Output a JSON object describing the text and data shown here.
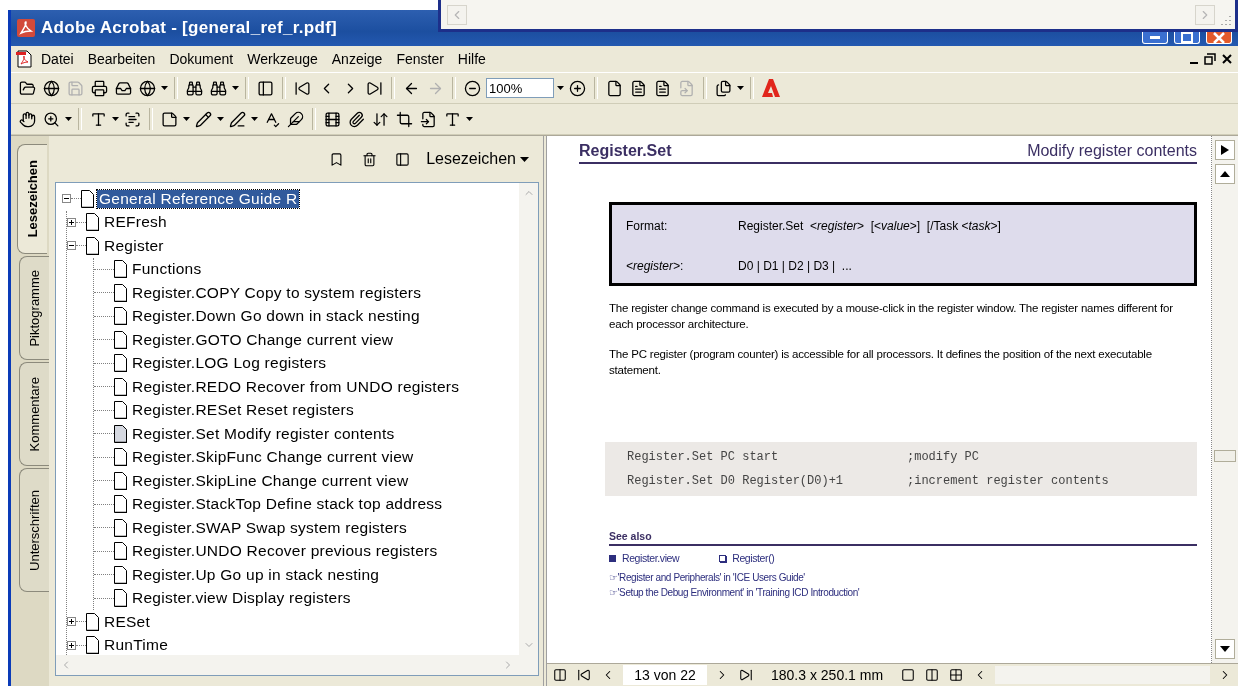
{
  "window": {
    "title": "Adobe Acrobat - [general_ref_r.pdf]"
  },
  "menu": [
    "Datei",
    "Bearbeiten",
    "Dokument",
    "Werkzeuge",
    "Anzeige",
    "Fenster",
    "Hilfe"
  ],
  "toolbar": {
    "zoom": "100%"
  },
  "side_tabs": [
    {
      "label": "Lesezeichen",
      "selected": true
    },
    {
      "label": "Piktogramme",
      "selected": false
    },
    {
      "label": "Kommentare",
      "selected": false
    },
    {
      "label": "Unterschriften",
      "selected": false
    }
  ],
  "bookmarks": {
    "menu": "Lesezeichen",
    "tree": [
      {
        "label": "General Reference Guide R",
        "expanded": true,
        "selected": true,
        "children": [
          {
            "label": "REFresh",
            "expanded": false,
            "selected": false
          },
          {
            "label": "Register",
            "expanded": true,
            "selected": false,
            "children": [
              {
                "label": "Functions",
                "current": false
              },
              {
                "label": "Register.COPY Copy to system registers",
                "current": false
              },
              {
                "label": "Register.Down Go down in stack nesting",
                "current": false
              },
              {
                "label": "Register.GOTO Change current view",
                "current": false
              },
              {
                "label": "Register.LOG Log registers",
                "current": false
              },
              {
                "label": "Register.REDO Recover from UNDO registers",
                "current": false
              },
              {
                "label": "Register.RESet Reset registers",
                "current": false
              },
              {
                "label": "Register.Set Modify register contents",
                "current": true
              },
              {
                "label": "Register.SkipFunc Change current view",
                "current": false
              },
              {
                "label": "Register.SkipLine Change current view",
                "current": false
              },
              {
                "label": "Register.StackTop Define stack top address",
                "current": false
              },
              {
                "label": "Register.SWAP Swap system registers",
                "current": false
              },
              {
                "label": "Register.UNDO Recover previous registers",
                "current": false
              },
              {
                "label": "Register.Up Go up in stack nesting",
                "current": false
              },
              {
                "label": "Register.view Display registers",
                "current": false
              }
            ]
          },
          {
            "label": "RESet",
            "expanded": false,
            "selected": false
          },
          {
            "label": "RunTime",
            "expanded": false,
            "selected": false
          }
        ]
      }
    ]
  },
  "document": {
    "heading": "Register.Set",
    "subtitle": "Modify register contents",
    "format": [
      {
        "label": "Format:",
        "value": "Register.Set  <*register*>  [<*value*>]  [/Task <*task*>]"
      },
      {
        "label": "*<register>*:",
        "value": "D0 | D1 | D2 | D3 |  ..."
      }
    ],
    "paragraphs": [
      "The register change command is executed by a mouse-click in the register window. The register names different for each processor architecture.",
      "The PC register (program counter) is accessible for all processors. It defines the position of the next executable statement."
    ],
    "code": [
      {
        "command": "Register.Set PC start",
        "comment": ";modify PC"
      },
      {
        "command": "Register.Set D0 Register(D0)+1",
        "comment": ";increment register contents"
      }
    ],
    "see_also": {
      "title": "See also",
      "links": [
        {
          "label": "Register.view",
          "kind": "filled"
        },
        {
          "label": "Register()",
          "kind": "hollow"
        }
      ],
      "references": [
        "☞'Register and Peripherals'  in 'ICE Users Guide'",
        "☞'Setup the Debug Environment'  in 'Training ICD Introduction'"
      ]
    }
  },
  "status_bar": {
    "page": "13 von 22",
    "size": "180.3 x 250.1 mm"
  }
}
